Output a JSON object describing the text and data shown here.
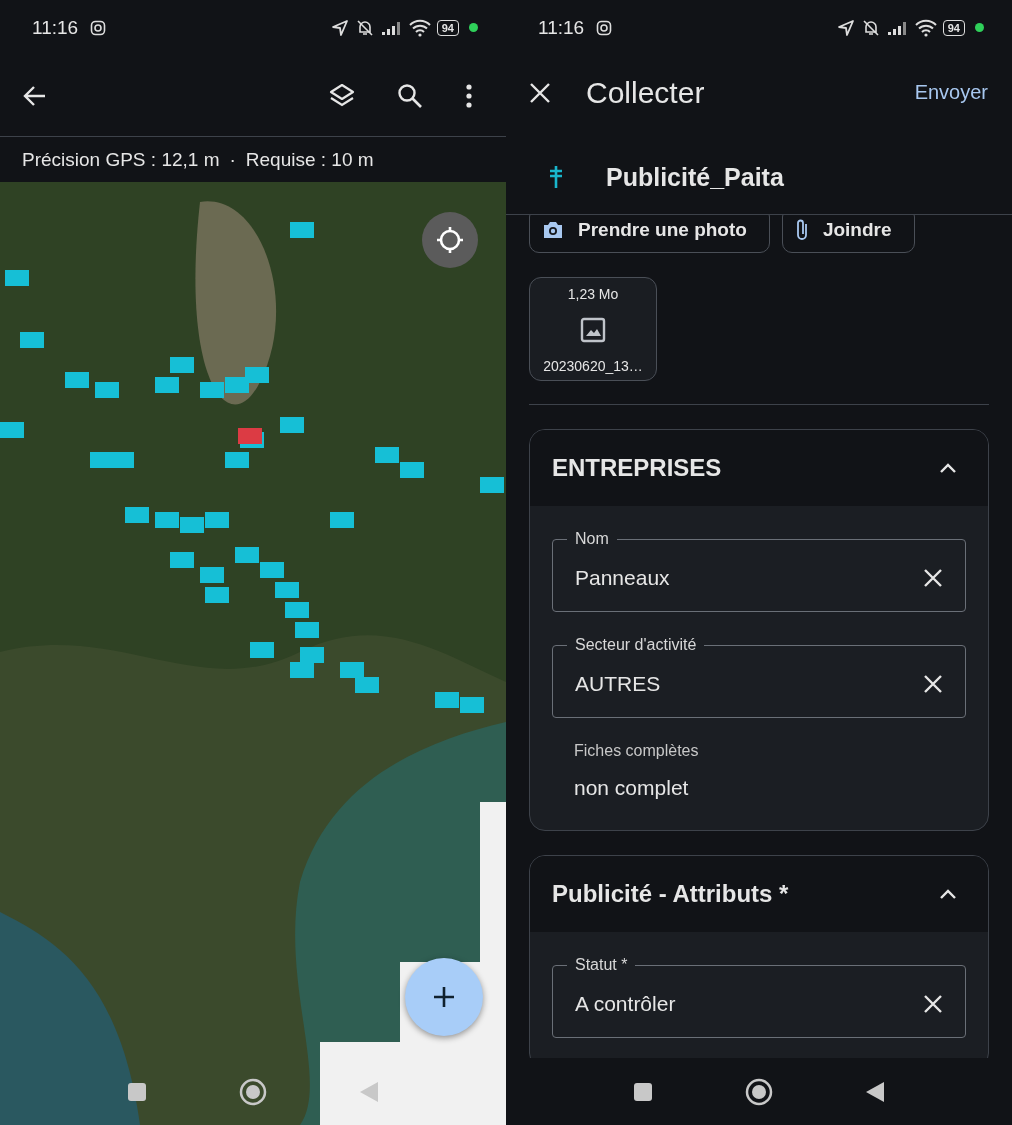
{
  "status_bars": [
    {
      "time": "11:16",
      "battery": "94"
    },
    {
      "time": "11:16",
      "battery": "94"
    }
  ],
  "map_screen": {
    "gps_accuracy": "Précision GPS : 12,1 m",
    "separator": "·",
    "required": "Requise : 10 m"
  },
  "form": {
    "title": "Collecter",
    "submit": "Envoyer",
    "layer": "Publicité_Paita",
    "attach_buttons": [
      {
        "kind": "camera",
        "label": "Prendre une photo"
      },
      {
        "kind": "clip",
        "label": "Joindre"
      }
    ],
    "attachment": {
      "size": "1,23 Mo",
      "name": "20230620_13…"
    },
    "sections": [
      {
        "title": "ENTREPRISES",
        "expanded": true,
        "fields": [
          {
            "kind": "text",
            "label": "Nom",
            "value": "Panneaux"
          },
          {
            "kind": "text",
            "label": "Secteur d'activité",
            "value": "AUTRES"
          },
          {
            "kind": "readonly",
            "label": "Fiches complètes",
            "value": "non complet"
          }
        ]
      },
      {
        "title": "Publicité - Attributs *",
        "expanded": true,
        "fields": [
          {
            "kind": "text",
            "label": "Statut *",
            "value": "A contrôler"
          }
        ]
      }
    ]
  }
}
